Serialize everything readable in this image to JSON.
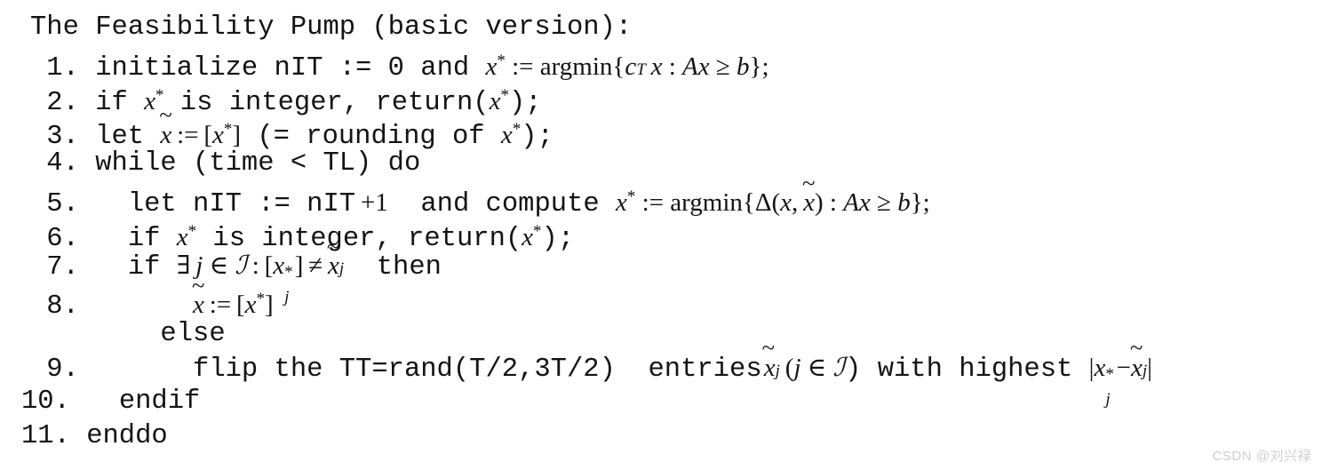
{
  "document": {
    "type": "algorithm-pseudocode",
    "title": "The Feasibility Pump (basic version):",
    "background_color": "#ffffff",
    "text_color": "#141414"
  },
  "steps": [
    {
      "number": "1.",
      "indent": 0,
      "code_before": "initialize nIT := 0 and ",
      "math": "x* := argmin{c^T x : Ax ≥ b};",
      "plain": "1. initialize nIT := 0 and x* := argmin{c^T x : Ax ≥ b};"
    },
    {
      "number": "2.",
      "indent": 0,
      "plain": "2. if x* is integer, return(x*);"
    },
    {
      "number": "3.",
      "indent": 0,
      "plain": "3. let x̃ := [x*] (= rounding of x*);"
    },
    {
      "number": "4.",
      "indent": 0,
      "plain": "4. while (time < TL) do"
    },
    {
      "number": "5.",
      "indent": 2,
      "plain": "5.   let nIT := nIT + 1  and compute x* := argmin{Δ(x, x̃) : Ax ≥ b};"
    },
    {
      "number": "6.",
      "indent": 2,
      "plain": "6.   if x* is integer, return(x*);"
    },
    {
      "number": "7.",
      "indent": 2,
      "plain": "7.   if ∃ j ∈ ℐ : [x*_j] ≠ x̃_j  then"
    },
    {
      "number": "8.",
      "indent": 5,
      "plain": "8.      x̃ := [x*]"
    },
    {
      "number": "",
      "indent": 4,
      "plain": "     else"
    },
    {
      "number": "9.",
      "indent": 6,
      "plain": "9.       flip the TT=rand(T/2,3T/2)  entries x̃_j (j ∈ ℐ) with highest |x*_j − x̃_j|"
    },
    {
      "number": "10.",
      "indent": 2,
      "plain": "10.   endif"
    },
    {
      "number": "11.",
      "indent": 0,
      "plain": "11. enddo"
    }
  ],
  "tokens": {
    "initialize_code": "initialize nIT := 0 and ",
    "if_code": "if ",
    "is_integer_code": " is integer, return(",
    "semicolon": ");",
    "let_code": "let ",
    "rounding_code": " (= rounding of ",
    "while_code": "while (time < TL) do",
    "let_nit_code": "let nIT := nIT",
    "plus_one": "+1",
    "and_compute_code": "  and compute ",
    "then_code": "  then",
    "else_code": "else",
    "flip_code": "flip the TT=rand(T/2,3T/2)  entries",
    "with_highest_code": ") with highest ",
    "endif_code": "endif",
    "enddo_code": "enddo",
    "argmin": "argmin",
    "assign": ":=",
    "colon": " : ",
    "geq": "≥",
    "neq": "≠",
    "exists": "∃",
    "element_of": "∈",
    "delta": "Δ",
    "minus": "−",
    "x": "x",
    "star": "*",
    "c": "c",
    "T_sup": "T",
    "A": "A",
    "b": "b",
    "j": "j",
    "I_cal": "ℐ",
    "lbrace": "{",
    "rbrace": "}",
    "lbracket": "[",
    "rbracket": "]",
    "lparen": "(",
    "rparen": ")",
    "bar": "|",
    "tilde": "̃",
    "comma": ","
  },
  "watermark": {
    "text": "CSDN @刘兴禄",
    "color": "#cfcfcf"
  }
}
